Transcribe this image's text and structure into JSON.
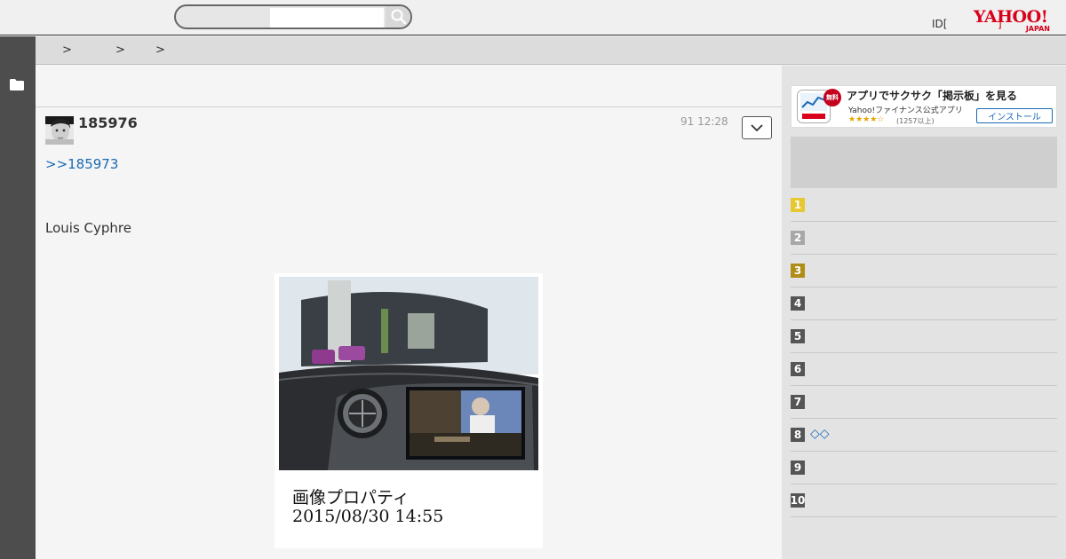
{
  "header": {
    "search_placeholder": "",
    "login_label": "ID[",
    "login_mark": "]",
    "logo_main": "YAHOO!",
    "logo_sub": "JAPAN"
  },
  "breadcrumb": [
    ">",
    ">",
    ">"
  ],
  "post": {
    "number": "185976",
    "time": "91 12:28",
    "reply_link": ">>185973",
    "body": "Louis Cyphre",
    "image_caption_line1": "画像プロパティ",
    "image_caption_line2": "2015/08/30 14:55"
  },
  "ad": {
    "badge": "無料",
    "title": "アプリでサクサク「掲示板」を見る",
    "subtitle": "Yahoo!ファイナンス公式アプリ",
    "stars": "★★★★☆",
    "reviews": "(1257以上)",
    "install_label": "インストール"
  },
  "ranking": [
    {
      "num": "1",
      "text": "",
      "color": "#e6c830"
    },
    {
      "num": "2",
      "text": "",
      "color": "#a8a8a8"
    },
    {
      "num": "3",
      "text": "",
      "color": "#b08d18"
    },
    {
      "num": "4",
      "text": "",
      "color": "#555555"
    },
    {
      "num": "5",
      "text": "",
      "color": "#555555"
    },
    {
      "num": "6",
      "text": "",
      "color": "#555555"
    },
    {
      "num": "7",
      "text": "",
      "color": "#555555"
    },
    {
      "num": "8",
      "text": "◇◇",
      "color": "#555555"
    },
    {
      "num": "9",
      "text": "",
      "color": "#555555"
    },
    {
      "num": "10",
      "text": "",
      "color": "#555555"
    }
  ],
  "icons": {
    "search": "search-icon",
    "folder": "folder-icon",
    "menu": "chevron-down-icon"
  }
}
